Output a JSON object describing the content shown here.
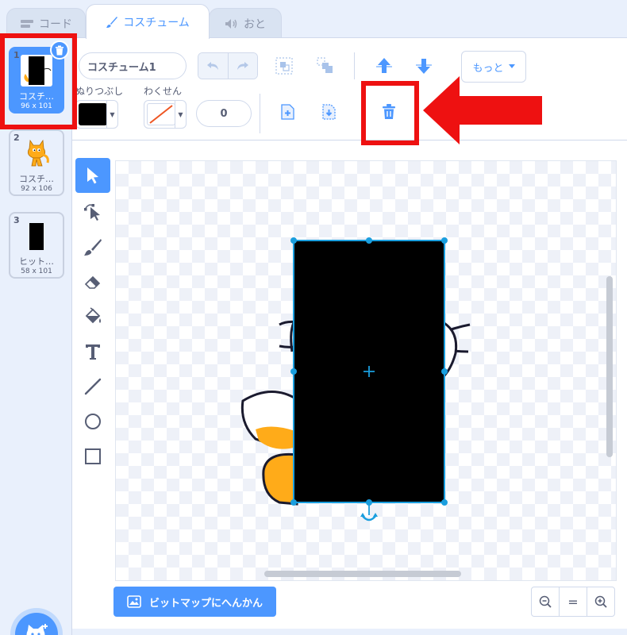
{
  "tabs": [
    {
      "label": "コード",
      "icon": "code-icon"
    },
    {
      "label": "コスチューム",
      "icon": "brush-icon",
      "active": true
    },
    {
      "label": "おと",
      "icon": "speaker-icon"
    }
  ],
  "costumes": [
    {
      "num": "1",
      "name": "コスチ…",
      "size": "96 x 101",
      "selected": true
    },
    {
      "num": "2",
      "name": "コスチ…",
      "size": "92 x 106"
    },
    {
      "num": "3",
      "name": "ヒット…",
      "size": "58 x 101"
    }
  ],
  "editor": {
    "costume_name": "コスチューム1",
    "more_label": "もっと",
    "fill_label": "ぬりつぶし",
    "outline_label": "わくせん",
    "outline_width": "0",
    "fill_color": "#000000",
    "convert_label": "ビットマップにへんかん",
    "zoom_reset_label": "="
  },
  "colors": {
    "accent": "#4c97ff",
    "highlight": "#ee1111",
    "cat_orange": "#ffab19",
    "selection": "#1a9ede"
  }
}
